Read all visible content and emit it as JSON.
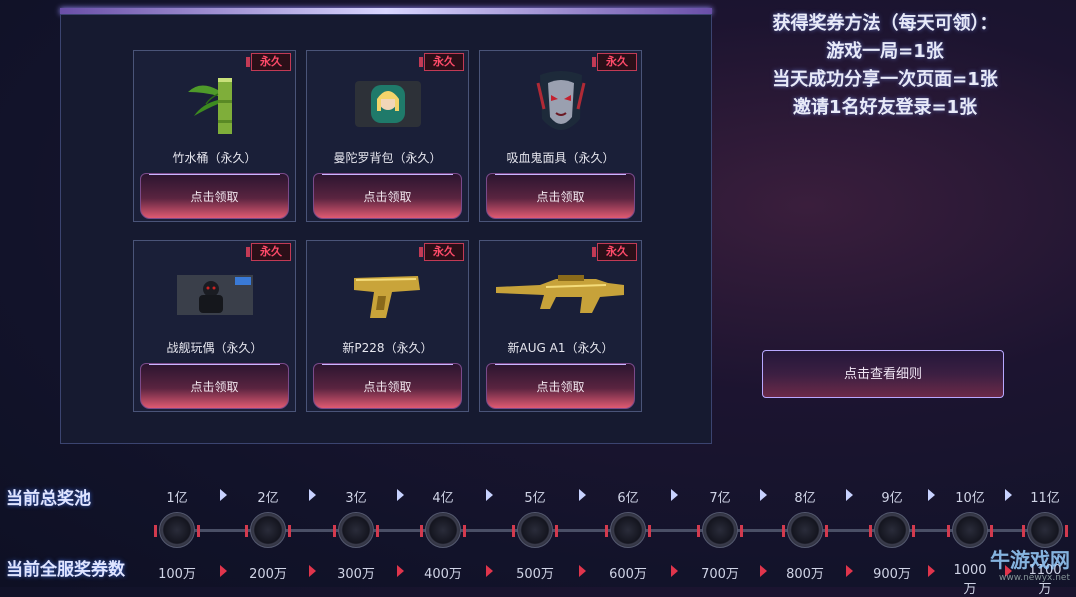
{
  "permanent_tag": "永久",
  "claim_label": "点击领取",
  "items": [
    {
      "name": "竹水桶（永久）",
      "icon": "bamboo-bucket-icon"
    },
    {
      "name": "曼陀罗背包（永久）",
      "icon": "mandala-backpack-icon"
    },
    {
      "name": "吸血鬼面具（永久）",
      "icon": "vampire-mask-icon"
    },
    {
      "name": "战舰玩偶（永久）",
      "icon": "battleship-doll-icon"
    },
    {
      "name": "新P228（永久）",
      "icon": "golden-pistol-icon"
    },
    {
      "name": "新AUG A1（永久）",
      "icon": "golden-rifle-icon"
    }
  ],
  "rules": {
    "title": "获得奖券方法（每天可领）：",
    "line1": "游戏一局=1张",
    "line2": "当天成功分享一次页面=1张",
    "line3": "邀请1名好友登录=1张"
  },
  "detail_button": "点击查看细则",
  "pool": {
    "label": "当前总奖池",
    "values": [
      "1亿",
      "2亿",
      "3亿",
      "4亿",
      "5亿",
      "6亿",
      "7亿",
      "8亿",
      "9亿",
      "10亿",
      "11亿"
    ]
  },
  "tickets": {
    "label": "当前全服奖券数",
    "values": [
      "100万",
      "200万",
      "300万",
      "400万",
      "500万",
      "600万",
      "700万",
      "800万",
      "900万",
      "1000万",
      "1100万"
    ]
  },
  "watermark": {
    "text": "牛游戏网",
    "url": "www.newyx.net"
  }
}
